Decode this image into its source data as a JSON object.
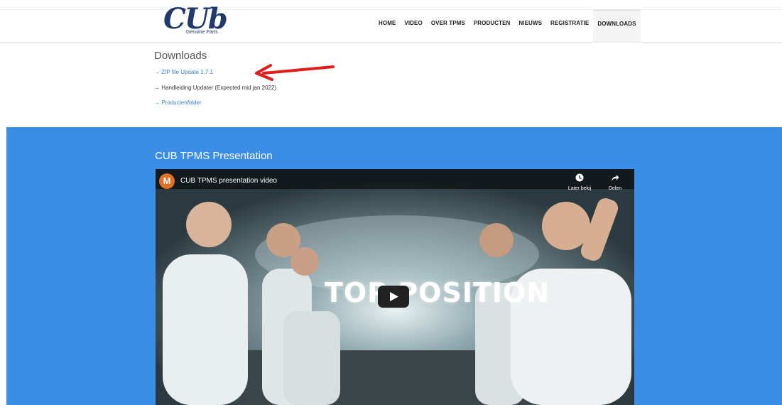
{
  "logo": {
    "word": "CUb",
    "tagline": "Genuine Parts"
  },
  "nav": {
    "items": [
      "HOME",
      "VIDEO",
      "OVER TPMS",
      "PRODUCTEN",
      "NIEUWS",
      "REGISTRATIE",
      "DOWNLOADS"
    ],
    "active": "DOWNLOADS"
  },
  "downloads": {
    "title": "Downloads",
    "links": [
      "→ ZIP file Update 1.7.1",
      "→ Handleiding Updater (Expected mid jan 2022)",
      "→ Productenfolder"
    ]
  },
  "presentation": {
    "title": "CUB TPMS Presentation",
    "video": {
      "channel_initial": "M",
      "title": "CUB TPMS presentation video",
      "later_label": "Later bekij",
      "share_label": "Delen",
      "overlay_text": "TOP POSITION"
    }
  },
  "colors": {
    "section_blue": "#3a8ee6",
    "link_blue": "#3d7fc4",
    "annotation_red": "#e21b1b"
  }
}
